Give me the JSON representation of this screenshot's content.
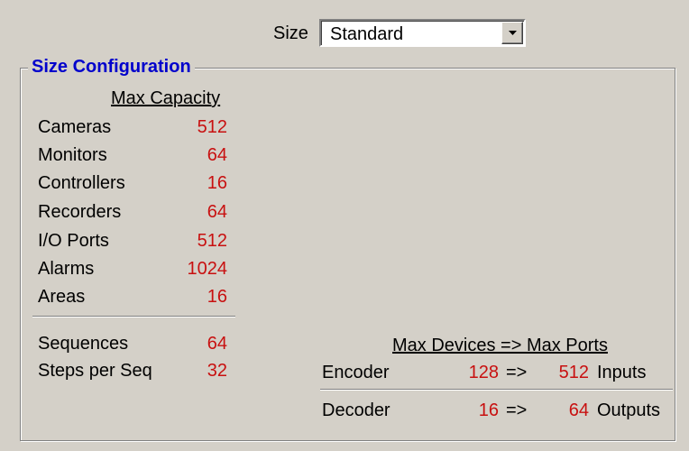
{
  "size": {
    "label": "Size",
    "selected": "Standard"
  },
  "group": {
    "title": "Size Configuration",
    "capacity_header": "Max Capacity",
    "items": [
      {
        "label": "Cameras",
        "value": "512"
      },
      {
        "label": "Monitors",
        "value": "64"
      },
      {
        "label": "Controllers",
        "value": "16"
      },
      {
        "label": "Recorders",
        "value": "64"
      },
      {
        "label": "I/O Ports",
        "value": "512"
      },
      {
        "label": "Alarms",
        "value": "1024"
      },
      {
        "label": "Areas",
        "value": "16"
      }
    ],
    "extra_items": [
      {
        "label": "Sequences",
        "value": "64"
      },
      {
        "label": "Steps per Seq",
        "value": "32"
      }
    ],
    "ports_header": "Max Devices => Max Ports",
    "ports": [
      {
        "device": "Encoder",
        "max_devices": "128",
        "arrow": "=>",
        "max_ports": "512",
        "unit": "Inputs"
      },
      {
        "device": "Decoder",
        "max_devices": "16",
        "arrow": "=>",
        "max_ports": "64",
        "unit": "Outputs"
      }
    ]
  },
  "colors": {
    "value_red": "#c81010",
    "title_blue": "#0000cc",
    "background": "#d4d0c8"
  },
  "icons": {
    "dropdown": "chevron-down-icon"
  }
}
